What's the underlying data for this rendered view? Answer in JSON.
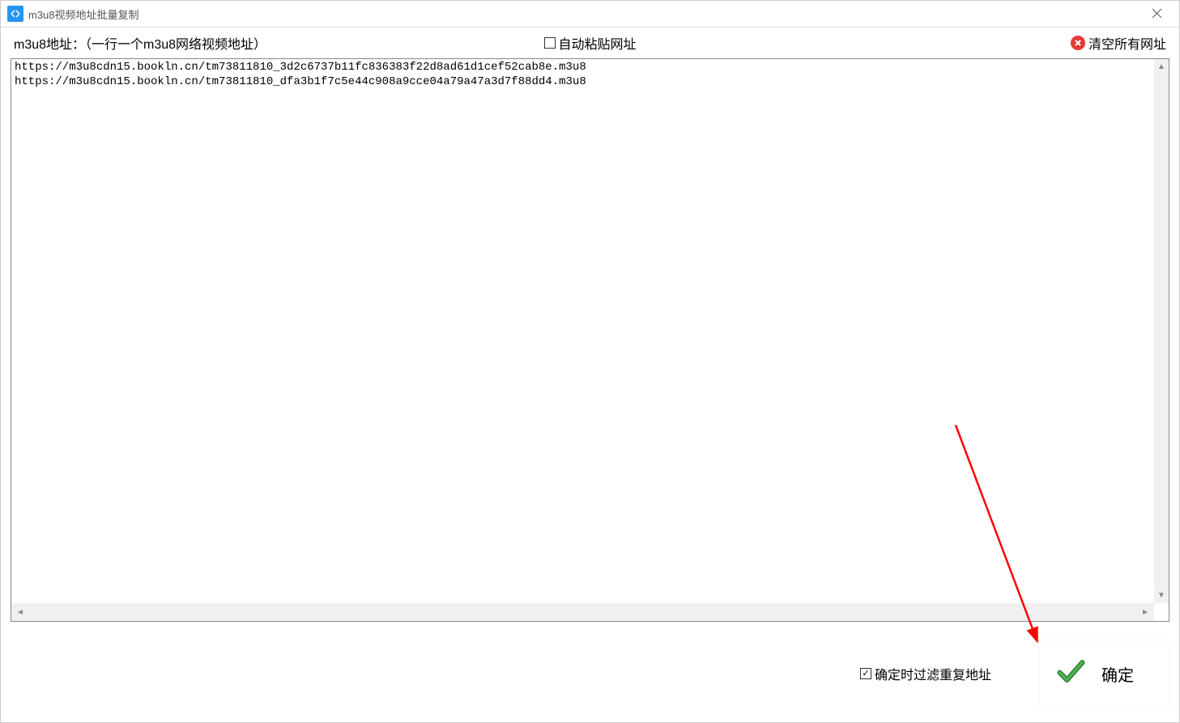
{
  "titlebar": {
    "title": "m3u8视频地址批量复制"
  },
  "toolbar": {
    "label": "m3u8地址：（一行一个m3u8网络视频地址）",
    "auto_paste_label": "自动粘贴网址",
    "auto_paste_checked": false,
    "clear_label": "清空所有网址"
  },
  "textarea": {
    "content": "https://m3u8cdn15.bookln.cn/tm73811810_3d2c6737b11fc836383f22d8ad61d1cef52cab8e.m3u8\nhttps://m3u8cdn15.bookln.cn/tm73811810_dfa3b1f7c5e44c908a9cce04a79a47a3d7f88dd4.m3u8"
  },
  "bottombar": {
    "filter_label": "确定时过滤重复地址",
    "filter_checked": true,
    "confirm_label": "确定"
  }
}
